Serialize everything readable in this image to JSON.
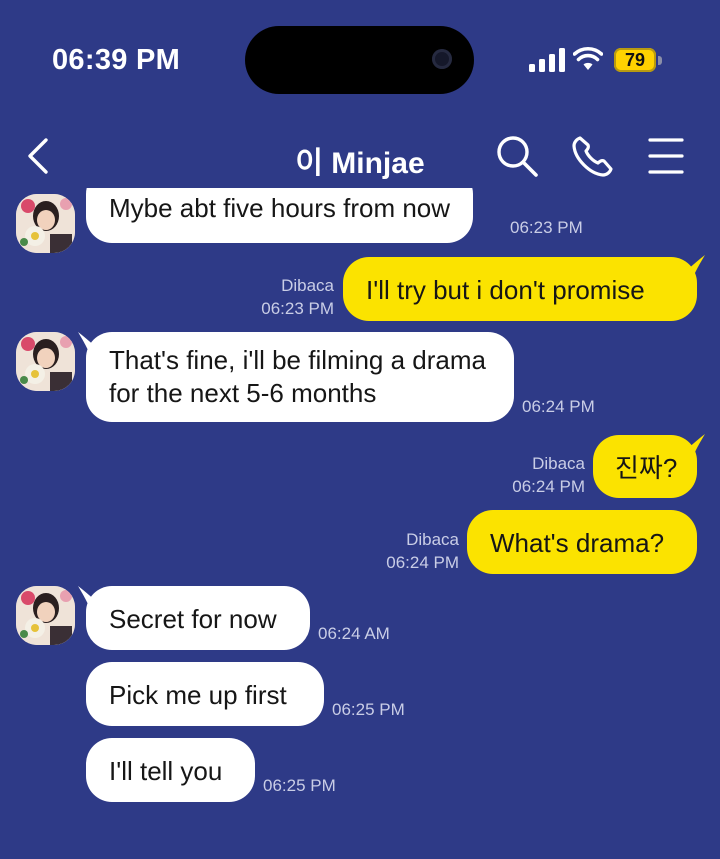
{
  "status_bar": {
    "time": "06:39 PM",
    "battery_level": "79",
    "battery_fraction": 0.79,
    "icons": [
      "signal-icon",
      "wifi-icon",
      "battery-icon"
    ]
  },
  "header": {
    "title": "이 Minjae",
    "icons": [
      "back-chevron-icon",
      "search-icon",
      "phone-icon",
      "menu-icon"
    ]
  },
  "colors": {
    "background": "#2e3a87",
    "outgoing_bubble": "#fbe300",
    "incoming_bubble": "#ffffff",
    "meta_text": "#c9cde6"
  },
  "messages": [
    {
      "direction": "in",
      "text": "Mybe abt five hours from now",
      "time": "06:23 PM"
    },
    {
      "direction": "out",
      "text": "I'll try but i don't promise",
      "status": "Dibaca",
      "time": "06:23 PM"
    },
    {
      "direction": "in",
      "text": "That's fine, i'll be filming a drama for the next 5-6 months",
      "time": "06:24 PM"
    },
    {
      "direction": "out",
      "text": "진짜?",
      "status": "Dibaca",
      "time": "06:24 PM"
    },
    {
      "direction": "out",
      "text": "What's drama?",
      "status": "Dibaca",
      "time": "06:24 PM"
    },
    {
      "direction": "in",
      "text": "Secret for now",
      "time": "06:24 AM"
    },
    {
      "direction": "in",
      "text": "Pick me up first",
      "time": "06:25 PM"
    },
    {
      "direction": "in",
      "text": "I'll tell you",
      "time": "06:25 PM"
    }
  ]
}
